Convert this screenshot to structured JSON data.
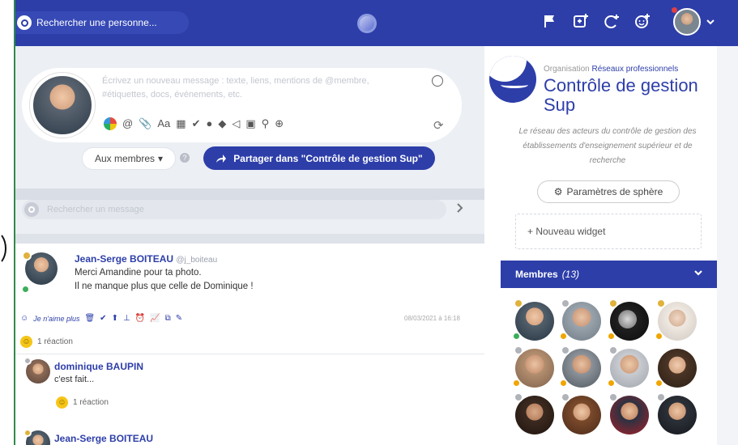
{
  "topbar": {
    "search_placeholder": "Rechercher une personne...",
    "icons": [
      "flag-icon",
      "add-sphere-icon",
      "add-event-icon",
      "add-user-icon"
    ],
    "caret": "⌄"
  },
  "compose": {
    "placeholder_line1": "Écrivez un nouveau message : texte, liens, mentions de @membre,",
    "placeholder_line2": "#étiquettes, docs, événements, etc.",
    "audience_label": "Aux membres",
    "share_label": "Partager dans \"Contrôle de gestion Sup\""
  },
  "message_search": {
    "placeholder": "Rechercher un message"
  },
  "posts": [
    {
      "author": "Jean-Serge BOITEAU",
      "handle": "@j_boiteau",
      "line1": "Merci Amandine pour ta photo.",
      "line2": "Il ne manque plus que celle de Dominique !",
      "like_label": "Je n'aime plus",
      "date": "08/03/2021 à 16:18",
      "reactions": "1 réaction"
    },
    {
      "author": "dominique BAUPIN",
      "text": "c'est fait...",
      "reactions": "1 réaction"
    },
    {
      "author": "Jean-Serge BOITEAU"
    }
  ],
  "organisation": {
    "kicker": "Organisation",
    "kicker_link": "Réseaux professionnels",
    "title": "Contrôle de gestion Sup",
    "description": "Le réseau des acteurs du contrôle de gestion des établissements d'enseignement supérieur et de recherche",
    "params_label": "Paramètres de sphère",
    "new_widget_label": "+ Nouveau widget"
  },
  "members": {
    "label": "Membres",
    "count": "(13)"
  },
  "colors": {
    "brand_blue": "#2d3ea9",
    "online_green": "#3cae5b",
    "away_orange": "#f0a500",
    "badge_gold": "#e0b23c"
  }
}
